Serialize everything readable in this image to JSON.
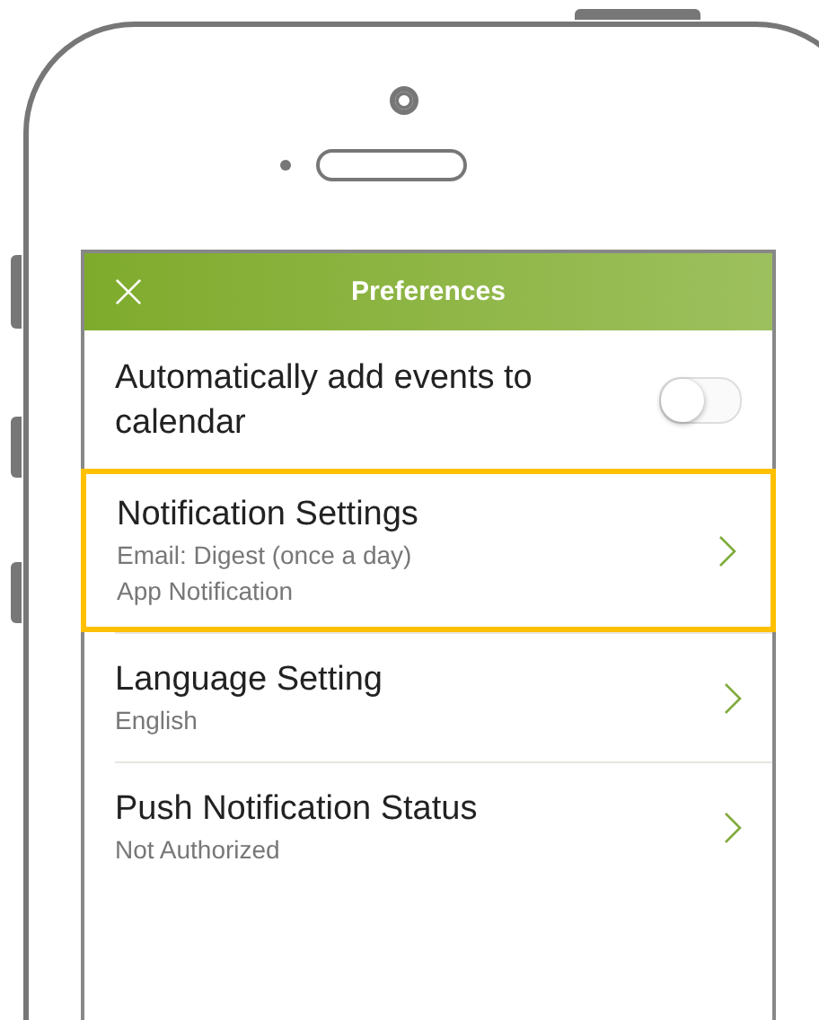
{
  "header": {
    "title": "Preferences"
  },
  "rows": [
    {
      "kind": "toggle",
      "title": "Automatically add events to calendar",
      "on": false,
      "selected": false
    },
    {
      "kind": "link",
      "title": "Notification Settings",
      "subtitles": [
        "Email: Digest (once a day)",
        "App Notification"
      ],
      "selected": true
    },
    {
      "kind": "link",
      "title": "Language Setting",
      "subtitles": [
        "English"
      ],
      "selected": false
    },
    {
      "kind": "link",
      "title": "Push Notification Status",
      "subtitles": [
        "Not Authorized"
      ],
      "selected": false
    }
  ]
}
